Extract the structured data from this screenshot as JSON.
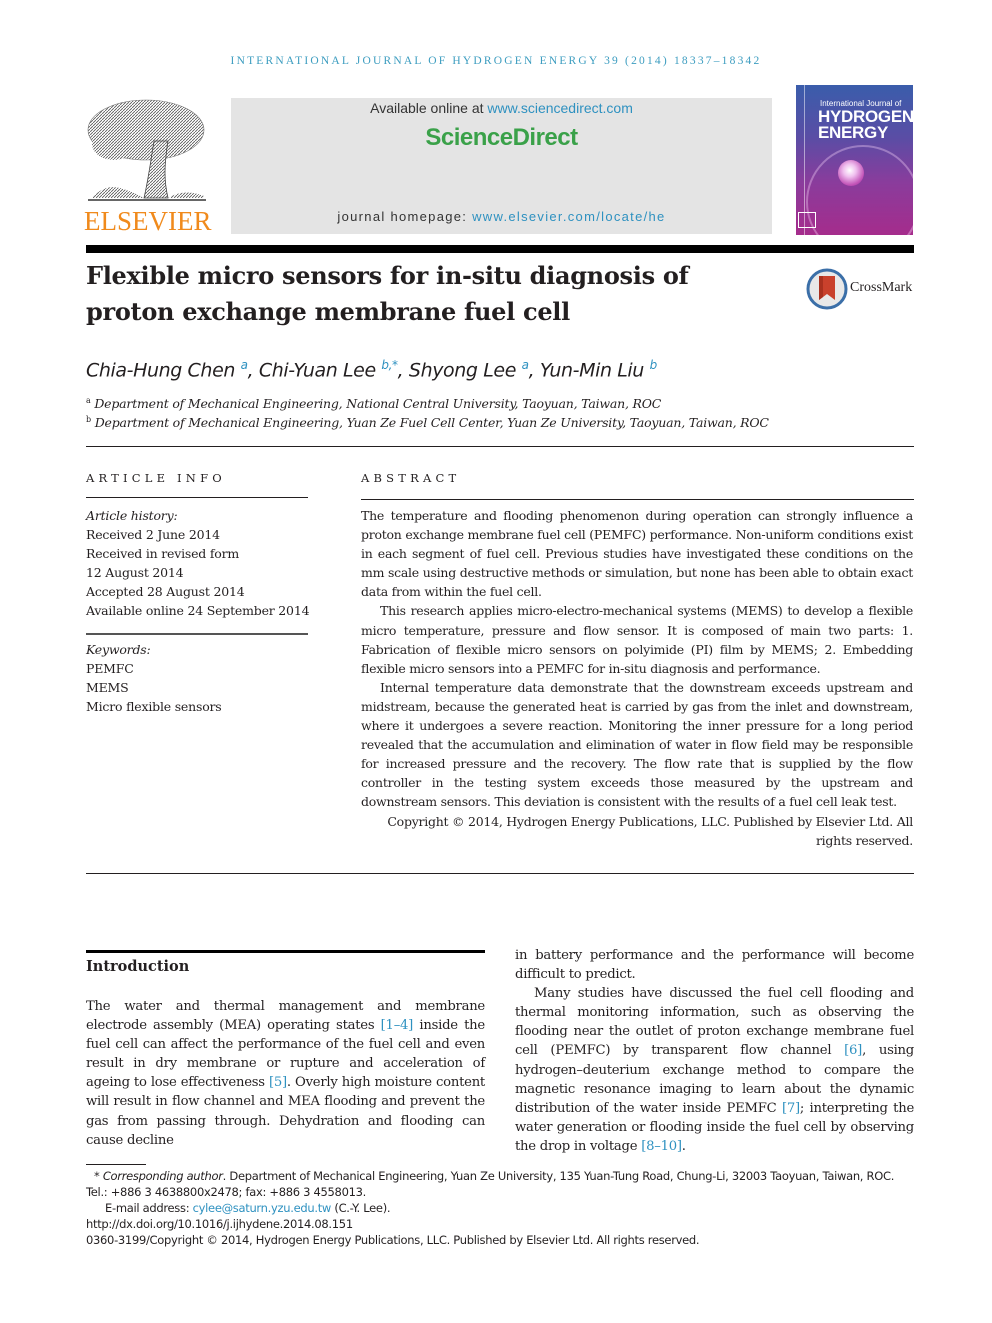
{
  "running_head": "INTERNATIONAL JOURNAL OF HYDROGEN ENERGY 39 (2014) 18337–18342",
  "publisher_logo": {
    "icon": "elsevier-tree-icon",
    "wordmark": "ELSEVIER"
  },
  "sciencedirect_box": {
    "available_prefix": "Available online at ",
    "available_link": "www.sciencedirect.com",
    "logo_text": "ScienceDirect",
    "homepage_prefix": "journal homepage: ",
    "homepage_link": "www.elsevier.com/locate/he"
  },
  "journal_cover": {
    "line1": "International Journal of",
    "line2": "HYDROGEN",
    "line3": "ENERGY"
  },
  "colors": {
    "link": "#2e91c0",
    "running_head": "#3d9dc0",
    "sciencedirect_green": "#3aa149",
    "elsevier_orange": "#f08a1c"
  },
  "article": {
    "title_line1": "Flexible micro sensors for in-situ diagnosis of",
    "title_line2": "proton exchange membrane fuel cell",
    "crossmark_label": "CrossMark",
    "authors": [
      {
        "name": "Chia-Hung Chen",
        "sup": "a"
      },
      {
        "name": "Chi-Yuan Lee",
        "sup": "b,*"
      },
      {
        "name": "Shyong Lee",
        "sup": "a"
      },
      {
        "name": "Yun-Min Liu",
        "sup": "b"
      }
    ],
    "author_separator": ", ",
    "affiliations": [
      {
        "mark": "a",
        "text": "Department of Mechanical Engineering, National Central University, Taoyuan, Taiwan, ROC"
      },
      {
        "mark": "b",
        "text": "Department of Mechanical Engineering, Yuan Ze Fuel Cell Center, Yuan Ze University, Taoyuan, Taiwan, ROC"
      }
    ]
  },
  "article_info": {
    "heading": "ARTICLE INFO",
    "history_label": "Article history:",
    "history": [
      "Received 2 June 2014",
      "Received in revised form",
      "12 August 2014",
      "Accepted 28 August 2014",
      "Available online 24 September 2014"
    ],
    "keywords_label": "Keywords:",
    "keywords": [
      "PEMFC",
      "MEMS",
      "Micro flexible sensors"
    ]
  },
  "abstract": {
    "heading": "ABSTRACT",
    "paragraphs": [
      "The temperature and flooding phenomenon during operation can strongly influence a proton exchange membrane fuel cell (PEMFC) performance. Non-uniform conditions exist in each segment of fuel cell. Previous studies have investigated these conditions on the mm scale using destructive methods or simulation, but none has been able to obtain exact data from within the fuel cell.",
      "This research applies micro-electro-mechanical systems (MEMS) to develop a flexible micro temperature, pressure and flow sensor. It is composed of main two parts: 1. Fabrication of flexible micro sensors on polyimide (PI) film by MEMS; 2. Embedding flexible micro sensors into a PEMFC for in-situ diagnosis and performance.",
      "Internal temperature data demonstrate that the downstream exceeds upstream and midstream, because the generated heat is carried by gas from the inlet and downstream, where it undergoes a severe reaction. Monitoring the inner pressure for a long period revealed that the accumulation and elimination of water in flow field may be responsible for increased pressure and the recovery. The flow rate that is supplied by the flow controller in the testing system exceeds those measured by the upstream and downstream sensors. This deviation is consistent with the results of a fuel cell leak test."
    ],
    "copyright": "Copyright © 2014, Hydrogen Energy Publications, LLC. Published by Elsevier Ltd. All rights reserved."
  },
  "introduction": {
    "heading": "Introduction",
    "left_col": {
      "p1_a": "The water and thermal management and membrane electrode assembly (MEA) operating states ",
      "cite1": "[1–4]",
      "p1_b": " inside the fuel cell can affect the performance of the fuel cell and even result in dry membrane or rupture and acceleration of ageing to lose effectiveness ",
      "cite2": "[5]",
      "p1_c": ". Overly high moisture content will result in flow channel and MEA flooding and prevent the gas from passing through. Dehydration and flooding can cause decline"
    },
    "right_col": {
      "p1_cont": "in battery performance and the performance will become difficult to predict.",
      "p2_a": "Many studies have discussed the fuel cell flooding and thermal monitoring information, such as observing the flooding near the outlet of proton exchange membrane fuel cell (PEMFC) by transparent flow channel ",
      "cite6": "[6]",
      "p2_b": ", using hydrogen–deuterium exchange method to compare the magnetic resonance imaging to learn about the dynamic distribution of the water inside PEMFC ",
      "cite7": "[7]",
      "p2_c": "; interpreting the water generation or flooding inside the fuel cell by observing the drop in voltage ",
      "cite8": "[8–10]",
      "p2_d": "."
    }
  },
  "footnotes": {
    "corresponding_mark": "*",
    "corresponding_label": "Corresponding author",
    "corresponding_text": ". Department of Mechanical Engineering, Yuan Ze University, 135 Yuan-Tung Road, Chung-Li, 32003 Taoyuan, Taiwan, ROC. Tel.: +886 3 4638800x2478; fax: +886 3 4558013.",
    "email_label": "E-mail address: ",
    "email": "cylee@saturn.yzu.edu.tw",
    "email_suffix": " (C.-Y. Lee).",
    "doi": "http://dx.doi.org/10.1016/j.ijhydene.2014.08.151",
    "issn_copyright": "0360-3199/Copyright © 2014, Hydrogen Energy Publications, LLC. Published by Elsevier Ltd. All rights reserved."
  }
}
